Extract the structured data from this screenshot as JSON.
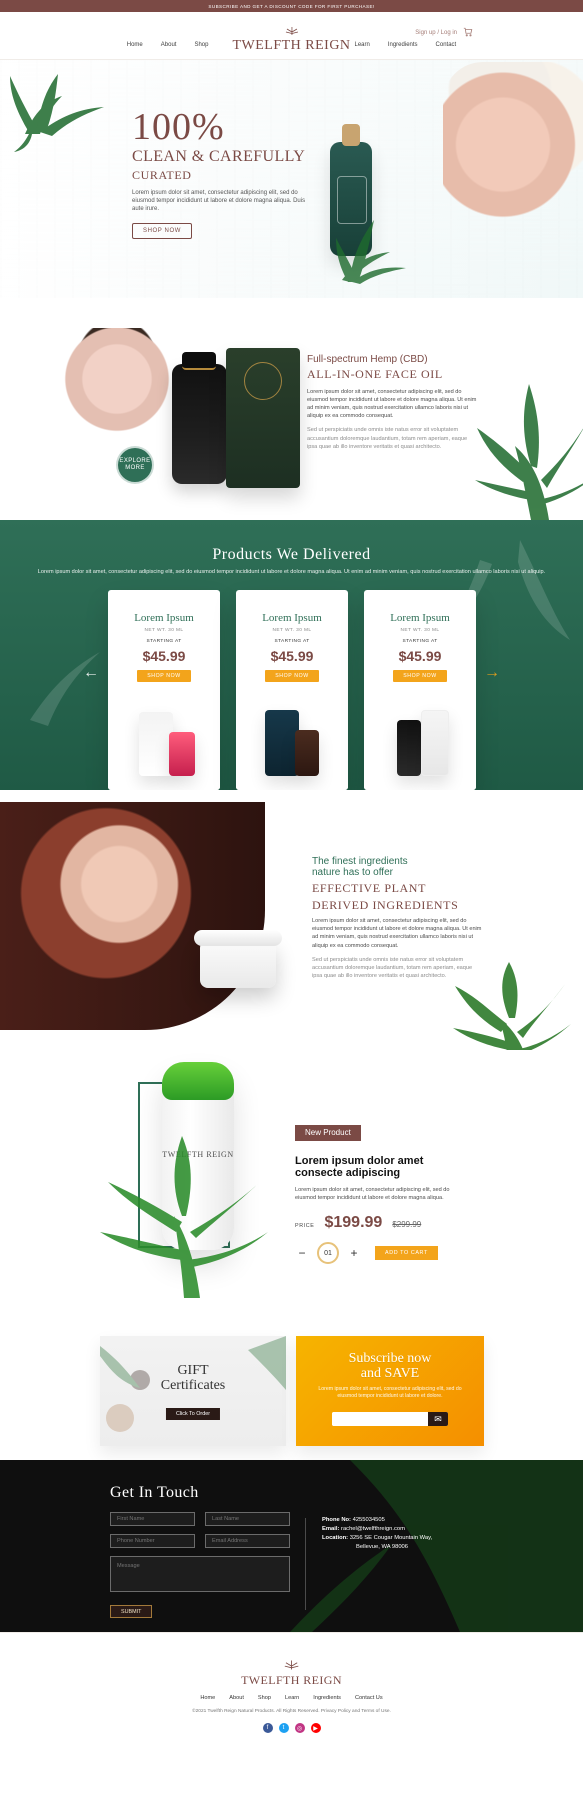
{
  "topbar": {
    "text": "SUBSCRIBE AND GET A DISCOUNT CODE FOR FIRST PURCHASE!"
  },
  "header": {
    "nav_left": [
      "Home",
      "About",
      "Shop"
    ],
    "brand": "TWELFTH REIGN",
    "nav_right": [
      "Learn",
      "Ingredients",
      "Contact"
    ],
    "util_text": "Sign up / Log in"
  },
  "hero": {
    "big": "100%",
    "line1": "CLEAN & CAREFULLY",
    "line2": "CURATED",
    "desc": "Lorem ipsum dolor sit amet, consectetur adipiscing elit, sed do eiusmod tempor incididunt ut labore et dolore magna aliqua. Duis aute irure.",
    "cta": "SHOP NOW"
  },
  "oil": {
    "kicker": "Full-spectrum Hemp (CBD)",
    "title": "ALL-IN-ONE FACE OIL",
    "p1": "Lorem ipsum dolor sit amet, consectetur adipiscing elit, sed do eiusmod tempor incididunt ut labore et dolore magna aliqua. Ut enim ad minim veniam, quis nostrud exercitation ullamco laboris nisi ut aliquip ex ea commodo consequat.",
    "p2": "Sed ut perspiciatis unde omnis iste natus error sit voluptatem accusantium doloremque laudantium, totam rem aperiam, eaque ipsa quae ab illo inventore veritatis et quasi architecto.",
    "explore": "EXPLORE MORE"
  },
  "products": {
    "title": "Products We Delivered",
    "subtitle": "Lorem ipsum dolor sit amet, consectetur adipiscing elit, sed do eiusmod tempor incididunt ut labore et dolore magna aliqua. Ut enim ad minim veniam, quis nostrud exercitation ullamco laboris nisi ut aliquip.",
    "arrow_left": "←",
    "arrow_right": "→",
    "cards": [
      {
        "name": "Lorem Ipsum",
        "net": "NET WT. 30 ML",
        "starting": "STARTING AT",
        "price": "$45.99",
        "cta": "SHOP NOW"
      },
      {
        "name": "Lorem Ipsum",
        "net": "NET WT. 30 ML",
        "starting": "STARTING AT",
        "price": "$45.99",
        "cta": "SHOP NOW"
      },
      {
        "name": "Lorem Ipsum",
        "net": "NET WT. 30 ML",
        "starting": "STARTING AT",
        "price": "$45.99",
        "cta": "SHOP NOW"
      }
    ]
  },
  "ingredients": {
    "k1": "The finest ingredients",
    "k2": "nature has to offer",
    "t1": "EFFECTIVE PLANT",
    "t2": "DERIVED INGREDIENTS",
    "p1": "Lorem ipsum dolor sit amet, consectetur adipiscing elit, sed do eiusmod tempor incididunt ut labore et dolore magna aliqua. Ut enim ad minim veniam, quis nostrud exercitation ullamco laboris nisi ut aliquip ex ea commodo consequat.",
    "p2": "Sed ut perspiciatis unde omnis iste natus error sit voluptatem accusantium doloremque laudantium, totam rem aperiam, eaque ipsa quae ab illo inventore veritatis et quasi architecto."
  },
  "new_product": {
    "badge": "New Product",
    "name": "Lorem ipsum dolor amet consecte adipiscing",
    "desc": "Lorem ipsum dolor sit amet, consectetur adipiscing elit, sed do eiusmod tempor incididunt ut labore et dolore magna aliqua.",
    "price_label": "PRICE",
    "price": "$199.99",
    "old_price": "$299.99",
    "qty": "01",
    "cta": "ADD TO CART",
    "brand": "TWELFTH REIGN"
  },
  "promo": {
    "gift_title_1": "GIFT",
    "gift_title_2": "Certificates",
    "gift_cta": "Click To Order",
    "sub_title_1": "Subscribe now",
    "sub_title_2": "and SAVE",
    "sub_desc": "Lorem ipsum dolor sit amet, consectetur adipiscing elit, sed do eiusmod tempor incididunt ut labore et dolore.",
    "email_placeholder": "",
    "send_icon": "✉"
  },
  "contact": {
    "title": "Get In Touch",
    "first_name": "First Name",
    "last_name": "Last Name",
    "phone": "Phone Number",
    "email": "Email Address",
    "message": "Message",
    "submit": "SUBMIT",
    "phone_label": "Phone No:",
    "phone_value": "4255034505",
    "email_label": "Email:",
    "email_value": "rachel@twelfthreign.com",
    "loc_label": "Location:",
    "loc_value_1": "3256 SE Cougar Mountain Way,",
    "loc_value_2": "Bellevue, WA 98006"
  },
  "footer": {
    "brand": "TWELFTH REIGN",
    "nav": [
      "Home",
      "About",
      "Shop",
      "Learn",
      "Ingredients",
      "Contact Us"
    ],
    "copy": "©2021 Twelfth Reign Natural Products. All Rights Reserved. Privacy Policy and Terms of Use.",
    "social": [
      {
        "name": "facebook-icon",
        "glyph": "f",
        "color": "#3b5998"
      },
      {
        "name": "twitter-icon",
        "glyph": "t",
        "color": "#1da1f2"
      },
      {
        "name": "instagram-icon",
        "glyph": "◎",
        "color": "#c13584"
      },
      {
        "name": "youtube-icon",
        "glyph": "▶",
        "color": "#ff0000"
      }
    ]
  },
  "colors": {
    "maroon": "#7b4a45",
    "green": "#2f6f57",
    "orange": "#f3a41b"
  }
}
